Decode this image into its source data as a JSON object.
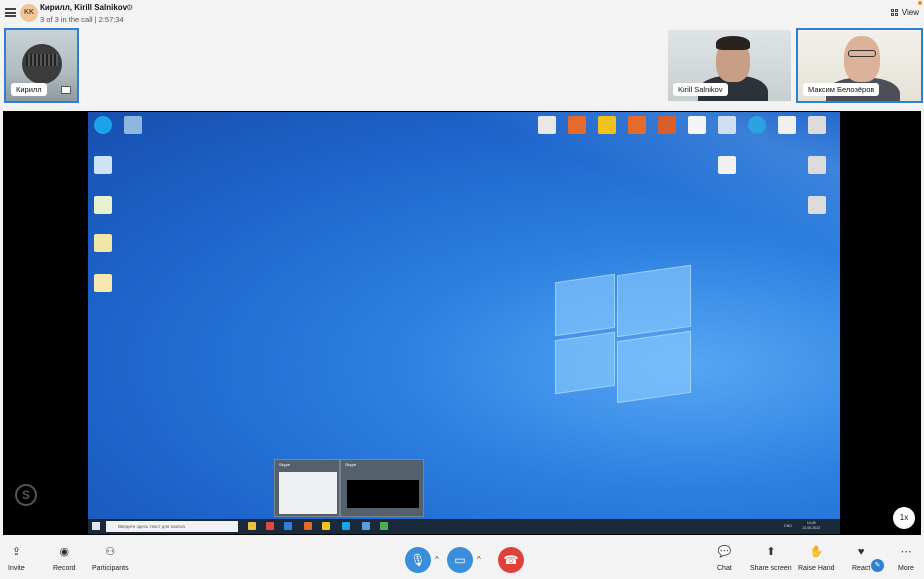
{
  "header": {
    "avatar_initials": "KK",
    "title": "Кирилл, Kirill Salnikov",
    "subtitle": "3 of 3 in the call | 2:57:34",
    "view_label": "View"
  },
  "participants": [
    {
      "name": "Кирилл"
    },
    {
      "name": "Kirill Salnikov"
    },
    {
      "name": "Максим Белозёров"
    }
  ],
  "shared_screen": {
    "taskbar_search_placeholder": "Введите здесь текст для поиска",
    "preview_titles": [
      "Skype",
      "Skype"
    ],
    "taskbar_time": "14:45",
    "taskbar_date": "22.06.2022",
    "taskbar_lang": "ENG"
  },
  "speed_badge": "1x",
  "toolbar": {
    "invite": "Invite",
    "record": "Record",
    "participants": "Participants",
    "chat": "Chat",
    "share_screen": "Share screen",
    "raise_hand": "Raise Hand",
    "react": "React",
    "more": "More"
  },
  "colors": {
    "accent": "#2f7fd0",
    "mic_button": "#3b8edb",
    "video_button": "#3b8edb",
    "hangup_button": "#e0403a"
  },
  "icons": {
    "menu": "hamburger-icon",
    "view": "grid-icon",
    "mic": "microphone-icon",
    "video": "video-camera-icon",
    "hangup": "phone-hangup-icon"
  }
}
